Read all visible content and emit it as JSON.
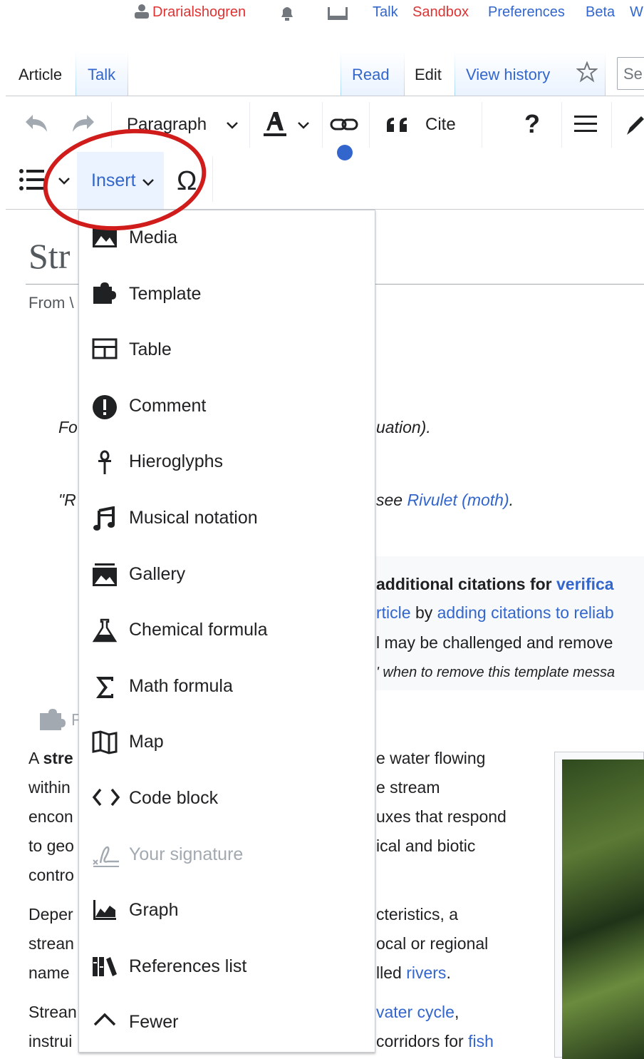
{
  "personal_tools": {
    "username": "Drarialshogren",
    "talk": "Talk",
    "sandbox": "Sandbox",
    "preferences": "Preferences",
    "beta": "Beta",
    "cut": "W"
  },
  "tabs": {
    "article": "Article",
    "talk": "Talk",
    "read": "Read",
    "edit": "Edit",
    "view_history": "View history",
    "search_placeholder": "Se"
  },
  "toolbar": {
    "paragraph": "Paragraph",
    "cite": "Cite",
    "help": "?",
    "insert": "Insert",
    "special_char": "Ω"
  },
  "insert_menu": {
    "items": [
      {
        "label": "Media",
        "icon": "media-icon",
        "enabled": true
      },
      {
        "label": "Template",
        "icon": "puzzle-icon",
        "enabled": true
      },
      {
        "label": "Table",
        "icon": "table-icon",
        "enabled": true
      },
      {
        "label": "Comment",
        "icon": "alert-icon",
        "enabled": true
      },
      {
        "label": "Hieroglyphs",
        "icon": "ankh-icon",
        "enabled": true
      },
      {
        "label": "Musical notation",
        "icon": "music-icon",
        "enabled": true
      },
      {
        "label": "Gallery",
        "icon": "gallery-icon",
        "enabled": true
      },
      {
        "label": "Chemical formula",
        "icon": "flask-icon",
        "enabled": true
      },
      {
        "label": "Math formula",
        "icon": "sigma-icon",
        "enabled": true
      },
      {
        "label": "Map",
        "icon": "map-icon",
        "enabled": true
      },
      {
        "label": "Code block",
        "icon": "code-icon",
        "enabled": true
      },
      {
        "label": "Your signature",
        "icon": "signature-icon",
        "enabled": false
      },
      {
        "label": "Graph",
        "icon": "graph-icon",
        "enabled": true
      },
      {
        "label": "References list",
        "icon": "references-icon",
        "enabled": true
      },
      {
        "label": "Fewer",
        "icon": "chevron-up-icon",
        "enabled": true
      }
    ]
  },
  "article": {
    "title_fragment": "Str",
    "from_fragment": "From \\",
    "hatnote1_left": "Fo",
    "hatnote1_right": "uation).",
    "hatnote2_left": "\"R",
    "hatnote2_right_pre": "see ",
    "hatnote2_link": "Rivulet (moth)",
    "hatnote2_end": ".",
    "citation_line1_pre": "additional citations for ",
    "citation_line1_link": "verifica",
    "citation_line2_link1": "rticle",
    "citation_line2_mid": " by ",
    "citation_line2_link2": "adding citations to reliab",
    "citation_line3": "l may be challenged and remove",
    "citation_line4": "' when to remove this template messa",
    "template_fragment": "F",
    "body_left": [
      "A stre",
      "within",
      "encon",
      "to geo",
      "contro",
      "Deper",
      "strean",
      "name",
      "Strean",
      "instrui"
    ],
    "body_right": [
      "e water flowing",
      "e stream",
      "uxes that respond",
      "ical and biotic",
      "",
      "cteristics, a",
      "ocal or regional",
      "lled rivers.",
      "vater cycle,",
      "corridors for fish"
    ]
  },
  "colors": {
    "link": "#3366cc",
    "user_red": "#dd3333",
    "annotation": "#d11c1c",
    "insert_bg": "#eaf3ff"
  }
}
